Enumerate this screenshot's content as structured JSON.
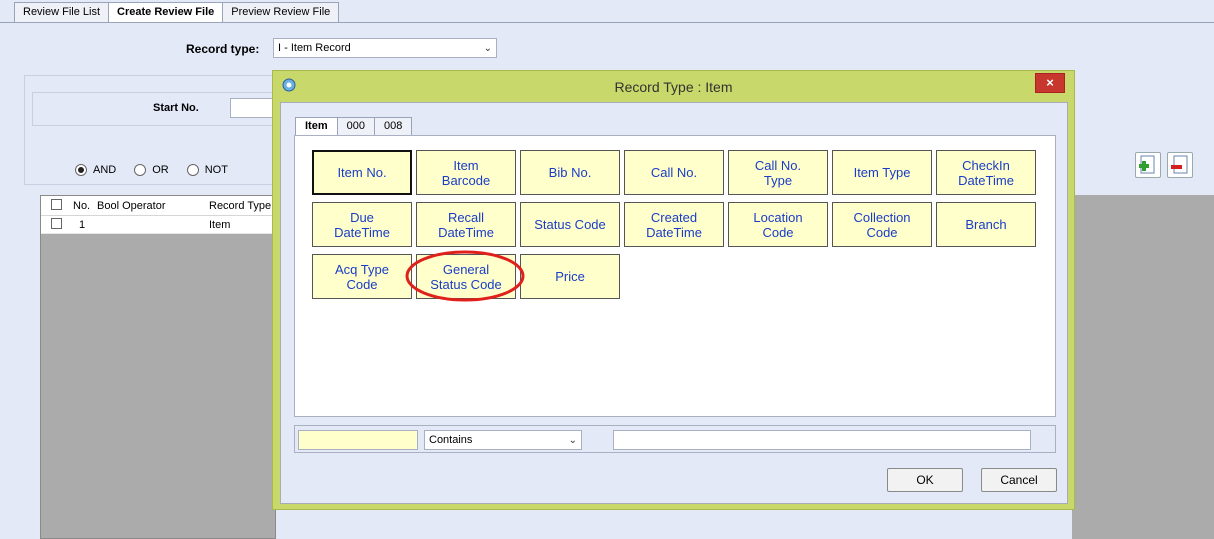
{
  "top_tabs": [
    "Review File List",
    "Create Review File",
    "Preview Review File"
  ],
  "record_type": {
    "label": "Record type:",
    "value": "I - Item Record"
  },
  "start_no": {
    "label": "Start No.",
    "value": ""
  },
  "bool_options": [
    "AND",
    "OR",
    "NOT"
  ],
  "grid": {
    "headers": [
      "No.",
      "Bool Operator",
      "Record Type"
    ],
    "rows": [
      {
        "no": "1",
        "bool": "",
        "type": "Item"
      }
    ]
  },
  "dialog": {
    "title": "Record Type : Item",
    "close": "×",
    "tabs": [
      "Item",
      "000",
      "008"
    ],
    "fields": [
      "Item No.",
      "Item\nBarcode",
      "Bib No.",
      "Call No.",
      "Call No.\nType",
      "Item Type",
      "CheckIn\nDateTime",
      "Due\nDateTime",
      "Recall\nDateTime",
      "Status Code",
      "Created\nDateTime",
      "Location\nCode",
      "Collection\nCode",
      "Branch",
      "Acq Type\nCode",
      "General\nStatus Code",
      "Price"
    ],
    "filter": {
      "field": "",
      "operator": "Contains",
      "value": ""
    },
    "ok": "OK",
    "cancel": "Cancel"
  },
  "colors": {
    "dialog_frame": "#c9d86a",
    "field_bg": "#ffffcc",
    "field_text": "#1a3cc7",
    "highlight_circle": "#e0201b"
  }
}
